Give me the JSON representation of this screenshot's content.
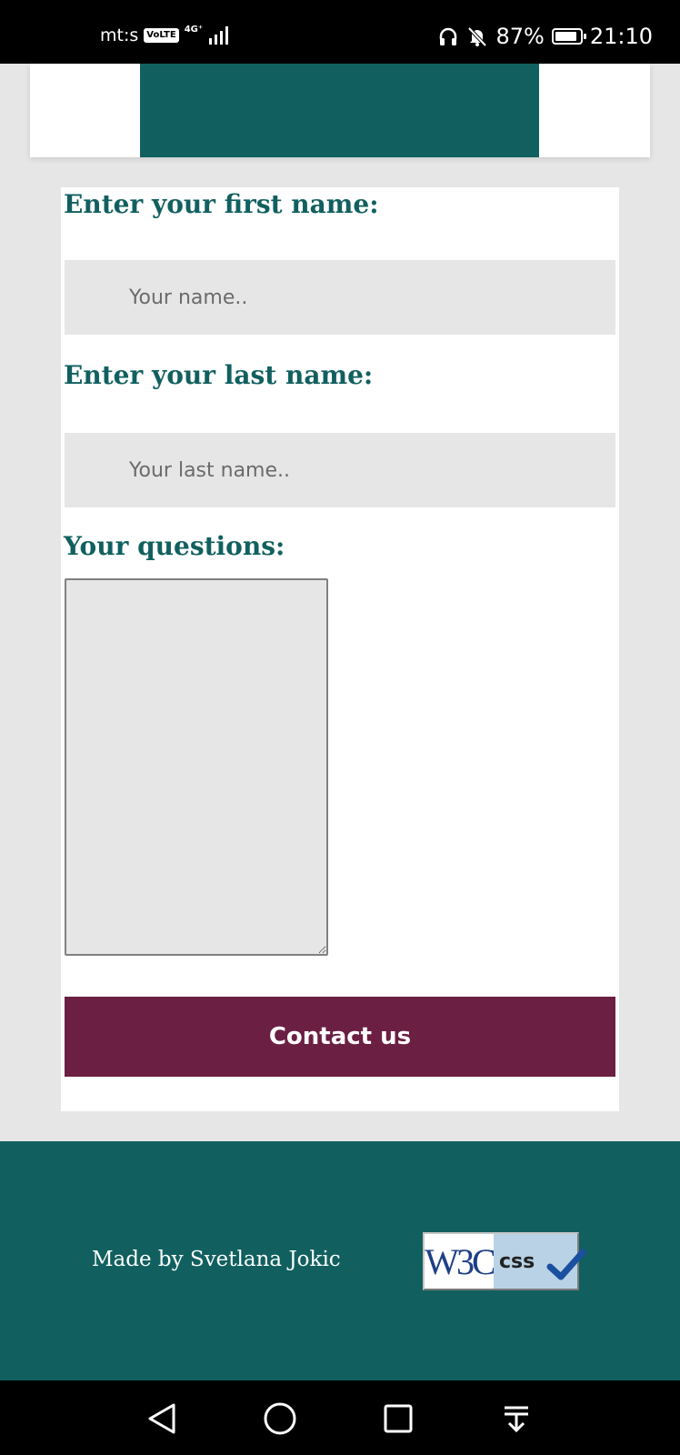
{
  "status_bar": {
    "carrier": "mt:s",
    "volte": "VoLTE",
    "network": "4G⁺",
    "battery_percent": "87%",
    "time": "21:10",
    "battery_level": 0.87,
    "icons": [
      "signal-icon",
      "headphones-icon",
      "bell-muted-icon",
      "battery-icon"
    ]
  },
  "header": {
    "accent_color": "#11605f"
  },
  "form": {
    "first_name_label": "Enter your first name:",
    "first_name_placeholder": "Your name..",
    "last_name_label": "Enter your last name:",
    "last_name_placeholder": "Your last name..",
    "questions_label": "Your questions:",
    "submit_label": "Contact us",
    "submit_color": "#6b1f43",
    "label_color": "#11605f"
  },
  "footer": {
    "credit": "Made by Svetlana Jokic",
    "badge_left": "W3C",
    "badge_right": "css",
    "background": "#11605f"
  },
  "nav_bar": {
    "icons": [
      "back-icon",
      "home-icon",
      "recents-icon",
      "notifications-pull-icon"
    ]
  }
}
